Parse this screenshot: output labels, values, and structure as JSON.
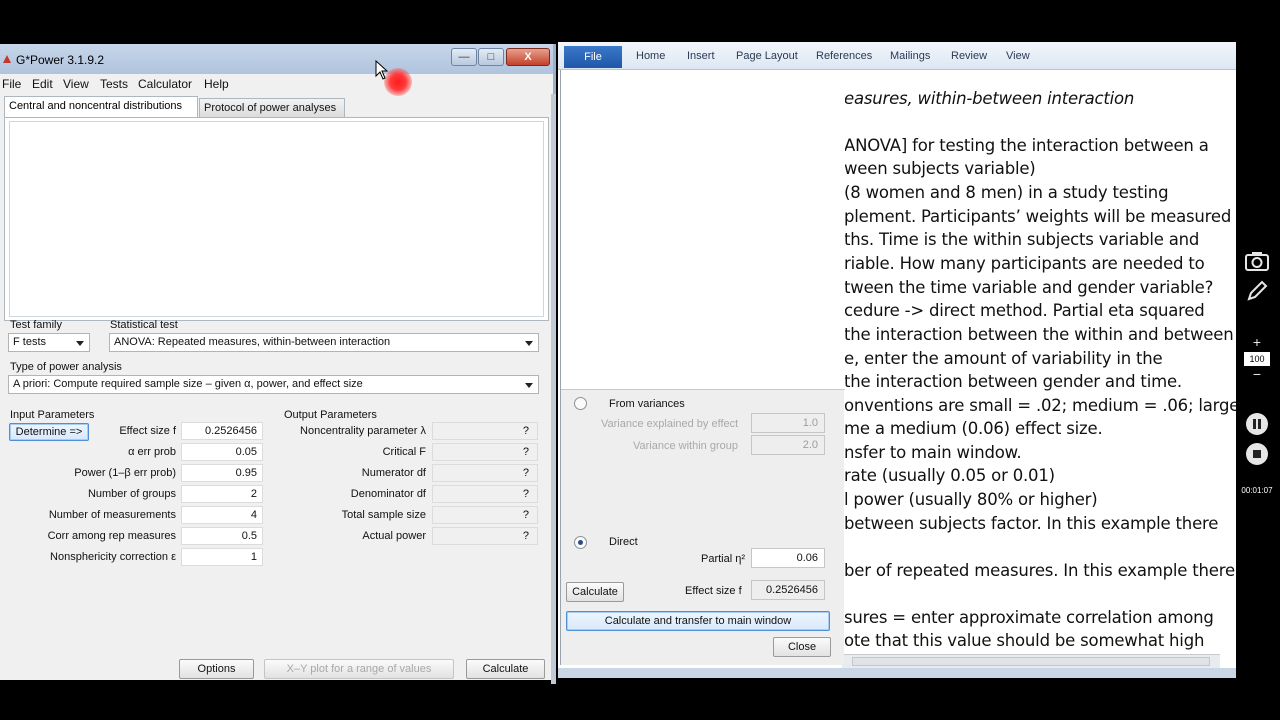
{
  "word": {
    "ribbon_tabs": [
      "File",
      "Home",
      "Insert",
      "Page Layout",
      "References",
      "Mailings",
      "Review",
      "View"
    ],
    "lines": [
      "easures, within-between interaction",
      "ANOVA] for testing the interaction between a",
      "ween subjects variable)",
      "(8 women and 8 men) in a study testing",
      "plement. Participants’ weights will be measured",
      "ths. Time is the within subjects variable and",
      "riable. How many participants are needed to",
      "tween the time variable and gender variable?",
      "cedure -> direct method. Partial eta squared",
      "the interaction between the within and between",
      "e, enter the amount of variability in the",
      "the interaction between gender and time.",
      "onventions are small = .02; medium = .06; large",
      "me a medium (0.06) effect size.",
      "nsfer to main window.",
      "rate (usually 0.05 or 0.01)",
      "l power (usually 80% or higher)",
      "between subjects factor. In this example there",
      "",
      "ber of repeated measures. In this example there",
      "",
      "sures = enter approximate correlation among",
      "ote that this value should be somewhat high"
    ]
  },
  "dialog": {
    "from_variances_label": "From variances",
    "variance_explained_label": "Variance explained by effect",
    "variance_explained_value": "1.0",
    "variance_within_label": "Variance within group",
    "variance_within_value": "2.0",
    "direct_label": "Direct",
    "partial_eta_label": "Partial η²",
    "partial_eta_value": "0.06",
    "calculate_label": "Calculate",
    "effect_size_label": "Effect size f",
    "effect_size_value": "0.2526456",
    "calc_transfer_label": "Calculate and transfer to main window",
    "close_label": "Close"
  },
  "gpower": {
    "title": "G*Power 3.1.9.2",
    "window_buttons": {
      "minimize": "—",
      "maximize": "□",
      "close": "X"
    },
    "menu": [
      "File",
      "Edit",
      "View",
      "Tests",
      "Calculator",
      "Help"
    ],
    "tabs": [
      "Central and noncentral distributions",
      "Protocol of power analyses"
    ],
    "test_family_label": "Test family",
    "test_family_value": "F tests",
    "statistical_test_label": "Statistical test",
    "statistical_test_value": "ANOVA: Repeated measures, within-between interaction",
    "type_label": "Type of power analysis",
    "type_value": "A priori: Compute required sample size – given α, power, and effect size",
    "input_header": "Input Parameters",
    "determine_label": "Determine =>",
    "inputs": [
      {
        "label": "Effect size f",
        "value": "0.2526456"
      },
      {
        "label": "α err prob",
        "value": "0.05"
      },
      {
        "label": "Power (1–β err prob)",
        "value": "0.95"
      },
      {
        "label": "Number of groups",
        "value": "2"
      },
      {
        "label": "Number of measurements",
        "value": "4"
      },
      {
        "label": "Corr among rep measures",
        "value": "0.5"
      },
      {
        "label": "Nonsphericity correction ε",
        "value": "1"
      }
    ],
    "output_header": "Output Parameters",
    "outputs": [
      {
        "label": "Noncentrality parameter λ",
        "value": "?"
      },
      {
        "label": "Critical F",
        "value": "?"
      },
      {
        "label": "Numerator df",
        "value": "?"
      },
      {
        "label": "Denominator df",
        "value": "?"
      },
      {
        "label": "Total sample size",
        "value": "?"
      },
      {
        "label": "Actual power",
        "value": "?"
      }
    ],
    "options_label": "Options",
    "xy_plot_label": "X–Y plot for a range of values",
    "calculate_label": "Calculate"
  },
  "recorder": {
    "zoom": "100",
    "plus": "+",
    "minus": "−",
    "timer": "00:01:07"
  }
}
